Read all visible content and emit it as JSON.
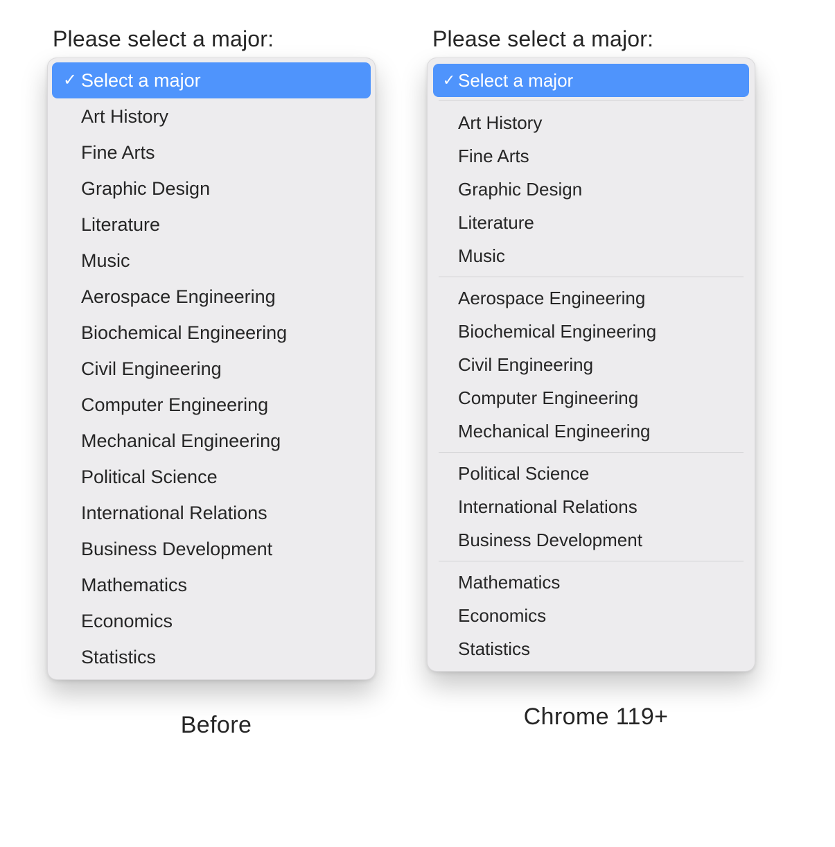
{
  "prompt_text": "Please select a major:",
  "selected_placeholder": "Select a major",
  "captions": {
    "before": "Before",
    "after": "Chrome 119+"
  },
  "colors": {
    "highlight": "#4F94FC",
    "menu_background": "#edecee",
    "separator": "#d2d2d4"
  },
  "options_flat": [
    "Art History",
    "Fine Arts",
    "Graphic Design",
    "Literature",
    "Music",
    "Aerospace Engineering",
    "Biochemical Engineering",
    "Civil Engineering",
    "Computer Engineering",
    "Mechanical Engineering",
    "Political Science",
    "International Relations",
    "Business Development",
    "Mathematics",
    "Economics",
    "Statistics"
  ],
  "option_groups": [
    {
      "items": [
        "Art History",
        "Fine Arts",
        "Graphic Design",
        "Literature",
        "Music"
      ]
    },
    {
      "items": [
        "Aerospace Engineering",
        "Biochemical Engineering",
        "Civil Engineering",
        "Computer Engineering",
        "Mechanical Engineering"
      ]
    },
    {
      "items": [
        "Political Science",
        "International Relations",
        "Business Development"
      ]
    },
    {
      "items": [
        "Mathematics",
        "Economics",
        "Statistics"
      ]
    }
  ]
}
